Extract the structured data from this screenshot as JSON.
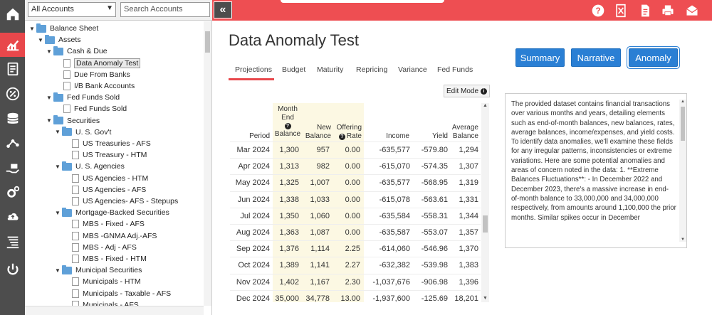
{
  "rail": {
    "items": [
      {
        "icon": "home-icon"
      },
      {
        "icon": "chart-icon"
      },
      {
        "icon": "report-icon"
      },
      {
        "icon": "percent-icon"
      },
      {
        "icon": "database-icon"
      },
      {
        "icon": "flow-icon"
      },
      {
        "icon": "hand-money-icon"
      },
      {
        "icon": "settings-icon"
      },
      {
        "icon": "cloud-upload-icon"
      },
      {
        "icon": "list-icon"
      },
      {
        "icon": "power-icon"
      }
    ],
    "active_index": 1
  },
  "tree_header": {
    "select_value": "All Accounts",
    "search_placeholder": "Search Accounts"
  },
  "tree": [
    {
      "label": "Balance Sheet",
      "type": "folder",
      "level": 0
    },
    {
      "label": "Assets",
      "type": "folder",
      "level": 1
    },
    {
      "label": "Cash & Due",
      "type": "folder",
      "level": 2
    },
    {
      "label": "Data Anomaly Test",
      "type": "doc",
      "level": 3,
      "selected": true
    },
    {
      "label": "Due From Banks",
      "type": "doc",
      "level": 3
    },
    {
      "label": "I/B Bank Accounts",
      "type": "doc",
      "level": 3
    },
    {
      "label": "Fed Funds Sold",
      "type": "folder",
      "level": 2
    },
    {
      "label": "Fed Funds Sold",
      "type": "doc",
      "level": 3
    },
    {
      "label": "Securities",
      "type": "folder",
      "level": 2
    },
    {
      "label": "U. S. Gov't",
      "type": "folder",
      "level": 3
    },
    {
      "label": "US Treasuries - AFS",
      "type": "doc",
      "level": 4
    },
    {
      "label": "US Treasury - HTM",
      "type": "doc",
      "level": 4
    },
    {
      "label": "U. S. Agencies",
      "type": "folder",
      "level": 3
    },
    {
      "label": "US Agencies - HTM",
      "type": "doc",
      "level": 4
    },
    {
      "label": "US Agencies - AFS",
      "type": "doc",
      "level": 4
    },
    {
      "label": "US Agencies- AFS - Stepups",
      "type": "doc",
      "level": 4
    },
    {
      "label": "Mortgage-Backed Securities",
      "type": "folder",
      "level": 3
    },
    {
      "label": "MBS - Fixed - AFS",
      "type": "doc",
      "level": 4
    },
    {
      "label": "MBS -GNMA Adj.-AFS",
      "type": "doc",
      "level": 4
    },
    {
      "label": "MBS - Adj - AFS",
      "type": "doc",
      "level": 4
    },
    {
      "label": "MBS - Fixed - HTM",
      "type": "doc",
      "level": 4
    },
    {
      "label": "Municipal Securities",
      "type": "folder",
      "level": 3
    },
    {
      "label": "Municipals - HTM",
      "type": "doc",
      "level": 4
    },
    {
      "label": "Municipals - Taxable - AFS",
      "type": "doc",
      "level": 4
    },
    {
      "label": "Municipals - AFS",
      "type": "doc",
      "level": 4
    }
  ],
  "top_icons": [
    "help-icon",
    "excel-icon",
    "document-icon",
    "print-icon",
    "email-icon"
  ],
  "page": {
    "title": "Data Anomaly Test",
    "buttons": [
      {
        "label": "Summary",
        "active": false
      },
      {
        "label": "Narrative",
        "active": false
      },
      {
        "label": "Anomaly",
        "active": true
      }
    ],
    "tabs": [
      "Projections",
      "Budget",
      "Maturity",
      "Repricing",
      "Variance",
      "Fed Funds"
    ],
    "active_tab": 0,
    "edit_mode_label": "Edit Mode"
  },
  "grid": {
    "headers": {
      "period": "Period",
      "month_end_balance": [
        "Month",
        "End",
        "Balance"
      ],
      "new_balance": [
        "New",
        "Balance"
      ],
      "offering_rate": [
        "Offering",
        "Rate"
      ],
      "income": "Income",
      "yield": "Yield",
      "average_balance": [
        "Average",
        "Balance"
      ]
    },
    "rows": [
      {
        "period": "Mar 2024",
        "meb": "1,300",
        "nb": "957",
        "rate": "0.00",
        "income": "-635,577",
        "yield": "-579.80",
        "avg": "1,294"
      },
      {
        "period": "Apr 2024",
        "meb": "1,313",
        "nb": "982",
        "rate": "0.00",
        "income": "-615,070",
        "yield": "-574.35",
        "avg": "1,307"
      },
      {
        "period": "May 2024",
        "meb": "1,325",
        "nb": "1,007",
        "rate": "0.00",
        "income": "-635,577",
        "yield": "-568.95",
        "avg": "1,319"
      },
      {
        "period": "Jun 2024",
        "meb": "1,338",
        "nb": "1,033",
        "rate": "0.00",
        "income": "-615,078",
        "yield": "-563.61",
        "avg": "1,331"
      },
      {
        "period": "Jul 2024",
        "meb": "1,350",
        "nb": "1,060",
        "rate": "0.00",
        "income": "-635,584",
        "yield": "-558.31",
        "avg": "1,344"
      },
      {
        "period": "Aug 2024",
        "meb": "1,363",
        "nb": "1,087",
        "rate": "0.00",
        "income": "-635,587",
        "yield": "-553.07",
        "avg": "1,357"
      },
      {
        "period": "Sep 2024",
        "meb": "1,376",
        "nb": "1,114",
        "rate": "2.25",
        "income": "-614,060",
        "yield": "-546.96",
        "avg": "1,370"
      },
      {
        "period": "Oct 2024",
        "meb": "1,389",
        "nb": "1,141",
        "rate": "2.27",
        "income": "-632,382",
        "yield": "-539.98",
        "avg": "1,383"
      },
      {
        "period": "Nov 2024",
        "meb": "1,402",
        "nb": "1,167",
        "rate": "2.30",
        "income": "-1,037,676",
        "yield": "-906.98",
        "avg": "1,396"
      },
      {
        "period": "Dec 2024",
        "meb": "35,000",
        "nb": "34,778",
        "rate": "13.00",
        "income": "-1,937,600",
        "yield": "-125.69",
        "avg": "18,201"
      }
    ]
  },
  "narrative": {
    "text": "The provided dataset contains financial transactions over various months and years, detailing elements such as end-of-month balances, new balances, rates, average balances, income/expenses, and yield costs. To identify data anomalies, we'll examine these fields for any irregular patterns, inconsistencies or extreme variations. Here are some potential anomalies and areas of concern noted in the data: 1. **Extreme Balances Fluctuations**: - In December 2022 and December 2023, there's a massive increase in end-of-month balance to 33,000,000 and 34,000,000 respectively, from amounts around 1,100,000 the prior months. Similar spikes occur in December"
  },
  "colors": {
    "accent_red": "#ee4e52",
    "rail_bg": "#4d4d4d",
    "button_blue": "#2a7fd4",
    "highlight_col": "#fcf8e3"
  }
}
